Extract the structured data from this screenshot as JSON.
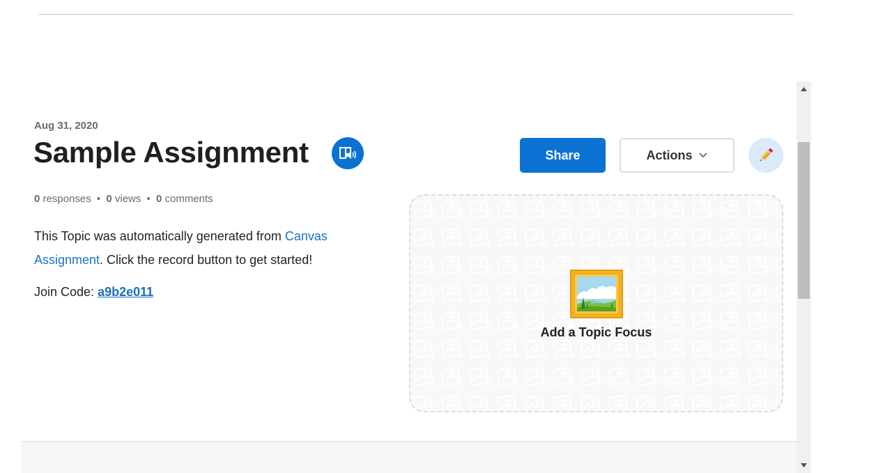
{
  "header": {
    "date": "Aug 31, 2020",
    "title": "Sample Assignment"
  },
  "stats": {
    "responses_count": "0",
    "responses_label": "responses",
    "views_count": "0",
    "views_label": "views",
    "comments_count": "0",
    "comments_label": "comments",
    "separator": "•"
  },
  "description": {
    "prefix": "This Topic was automatically generated from ",
    "link_text": "Canvas Assignment",
    "suffix": ". Click the record button to get started!"
  },
  "join_code": {
    "label": "Join Code: ",
    "value": "a9b2e011"
  },
  "toolbar": {
    "share_label": "Share",
    "actions_label": "Actions",
    "edit_icon": "pencil-icon",
    "immersive_reader_icon": "immersive-reader-icon"
  },
  "topic_focus": {
    "label": "Add a Topic Focus",
    "icon": "framed-picture-icon"
  },
  "colors": {
    "accent": "#0b72d4",
    "link": "#1a73c6",
    "edit_button_bg": "#dbeafa"
  }
}
